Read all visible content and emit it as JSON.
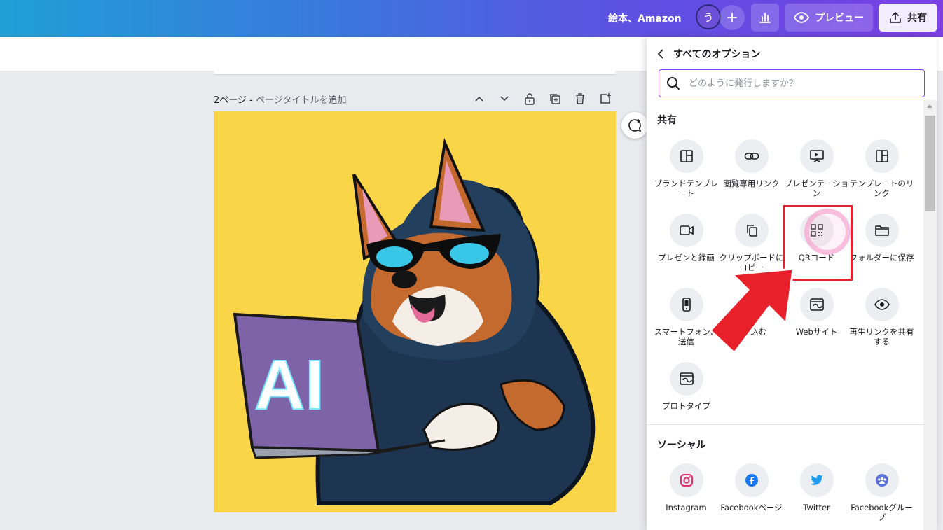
{
  "topbar": {
    "doc_title": "絵本、Amazon",
    "avatar_initial": "う",
    "preview_label": "プレビュー",
    "share_label": "共有"
  },
  "page": {
    "number_label": "2ページ - ",
    "title_placeholder": "ページタイトルを追加",
    "canvas_text": "AI"
  },
  "panel": {
    "back_title": "すべてのオプション",
    "search_placeholder": "どのように発行しますか？",
    "share_section": "共有",
    "share_options": [
      {
        "label": "ブランドテンプレート",
        "icon": "layout-icon"
      },
      {
        "label": "閲覧専用リンク",
        "icon": "link-icon"
      },
      {
        "label": "プレゼンテーション",
        "icon": "presentation-icon"
      },
      {
        "label": "テンプレートのリンク",
        "icon": "layout-icon"
      },
      {
        "label": "プレゼンと録画",
        "icon": "video-camera-icon"
      },
      {
        "label": "クリップボードにコピー",
        "icon": "copy-icon"
      },
      {
        "label": "QRコード",
        "icon": "qr-code-icon"
      },
      {
        "label": "フォルダーに保存",
        "icon": "folder-icon"
      },
      {
        "label": "スマートフォンに送信",
        "icon": "smartphone-icon"
      },
      {
        "label": "込む",
        "icon": "embed-icon"
      },
      {
        "label": "Webサイト",
        "icon": "website-icon"
      },
      {
        "label": "再生リンクを共有する",
        "icon": "eye-icon"
      },
      {
        "label": "プロトタイプ",
        "icon": "prototype-icon"
      }
    ],
    "social_section": "ソーシャル",
    "social_options": [
      {
        "label": "Instagram",
        "icon": "instagram-icon",
        "color": "#e1306c"
      },
      {
        "label": "Facebookページ",
        "icon": "facebook-icon",
        "color": "#1877f2"
      },
      {
        "label": "Twitter",
        "icon": "twitter-icon",
        "color": "#1d9bf0"
      },
      {
        "label": "Facebookグループ",
        "icon": "facebook-group-icon",
        "color": "#5b73d6"
      }
    ]
  },
  "colors": {
    "accent": "#8b3dff",
    "highlight": "#e0232f",
    "canvas_bg": "#fad548"
  }
}
